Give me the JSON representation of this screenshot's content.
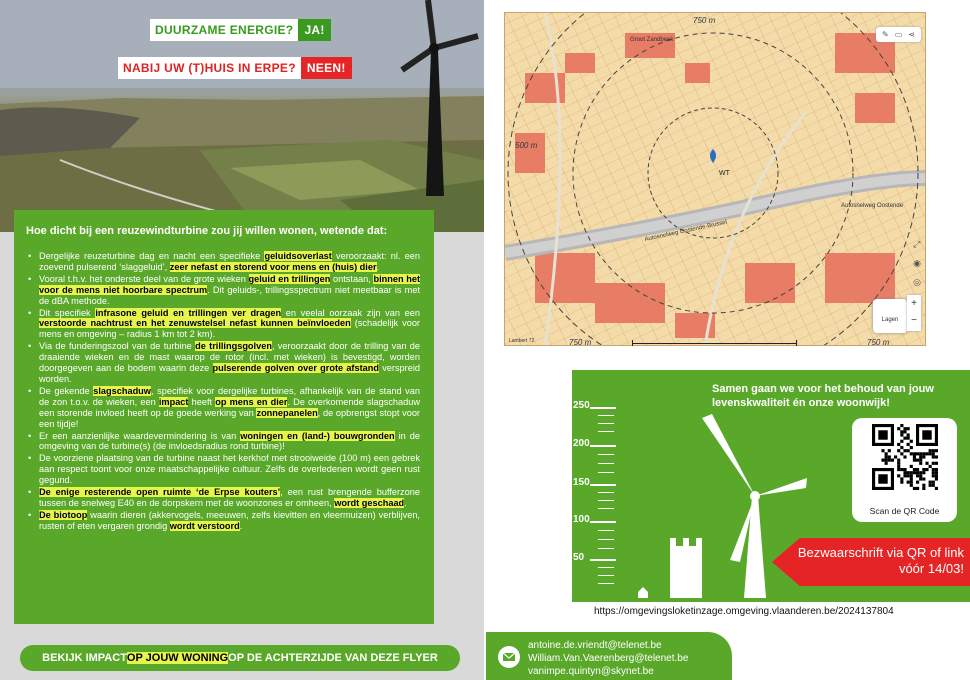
{
  "flyer_left": {
    "tag1": {
      "question": "DUURZAME ENERGIE?",
      "answer": "JA!"
    },
    "tag2": {
      "question": "NABIJ UW (T)HUIS IN ERPE?",
      "answer": "NEEN!"
    },
    "heading": "Hoe dicht bij een reuzewindturbine zou jij willen wonen, wetende dat:",
    "bullets": [
      [
        {
          "t": "Dergelijke reuzeturbine dag en nacht een specifieke "
        },
        {
          "t": "geluidsoverlast",
          "h": true
        },
        {
          "t": " veroorzaakt: nl. een zoevend pulserend ‘slaggeluid’, "
        },
        {
          "t": "zeer nefast en storend voor mens en (huis) dier",
          "h": true
        },
        {
          "t": "."
        }
      ],
      [
        {
          "t": "Vooral t.h.v. het onderste deel van de grote wieken "
        },
        {
          "t": "geluid en trillingen",
          "h": true
        },
        {
          "t": " ontstaan, "
        },
        {
          "t": "binnen het voor de mens niet hoorbare spectrum",
          "h": true
        },
        {
          "t": ". Dit geluids-, trillingsspectrum niet meetbaar is met de dBA methode."
        }
      ],
      [
        {
          "t": "Dit specifiek "
        },
        {
          "t": "infrasone geluid en trillingen ver dragen",
          "h": true
        },
        {
          "t": " en veelal oorzaak zijn van een "
        },
        {
          "t": "verstoorde nachtrust en het zenuwstelsel nefast kunnen beïnvloeden",
          "h": true
        },
        {
          "t": " (schadelijk voor mens en omgeving – radius 1 km tot 2 km)."
        }
      ],
      [
        {
          "t": "Via de funderingszool van de turbine "
        },
        {
          "t": "de trillingsgolven",
          "h": true
        },
        {
          "t": ", veroorzaakt door de trilling van de draaiende wieken en de mast waarop de rotor (incl. met wieken) is bevestigd, worden doorgegeven aan de bodem waarin deze "
        },
        {
          "t": "pulserende golven over grote afstand",
          "h": true
        },
        {
          "t": " verspreid worden."
        }
      ],
      [
        {
          "t": "De gekende "
        },
        {
          "t": "slagschaduw",
          "h": true
        },
        {
          "t": ", specifiek voor dergelijke turbines, afhankelijk van de stand van de zon t.o.v. de wieken, een "
        },
        {
          "t": "impact",
          "h": true
        },
        {
          "t": " heeft "
        },
        {
          "t": "op mens en dier",
          "h": true
        },
        {
          "t": ". De overkomende slagschaduw een storende invloed heeft op de goede werking van "
        },
        {
          "t": "zonnepanelen",
          "h": true
        },
        {
          "t": ", de opbrengst stopt voor een tijdje!"
        }
      ],
      [
        {
          "t": "Er een aanzienlijke waardevermindering is van "
        },
        {
          "t": "woningen en (land-) bouwgronden",
          "h": true
        },
        {
          "t": " in de omgeving van de turbine(s) (de invloedsradius rond turbine)!"
        }
      ],
      [
        {
          "t": "De voorziene plaatsing van de turbine naast het kerkhof met strooiweide (100 m) een gebrek aan respect toont voor onze maatschappelijke cultuur. Zelfs de overledenen wordt geen rust gegund."
        }
      ],
      [
        {
          "t": "De enige resterende open ruimte ‘de Erpse kouters’",
          "h": true
        },
        {
          "t": ", een rust brengende bufferzone tussen de snelweg E40 en de dorpskern met de woonzones er omheen, "
        },
        {
          "t": "wordt geschaad",
          "h": true
        },
        {
          "t": "."
        }
      ],
      [
        {
          "t": "De biotoop",
          "h": true
        },
        {
          "t": " waarin dieren (akkervogels, meeuwen, zelfs kievitten en vleermuizen) verblijven, rusten of eten vergaren grondig "
        },
        {
          "t": "wordt verstoord",
          "h": true
        },
        {
          "t": "."
        }
      ]
    ],
    "bottom_bar": {
      "pre": "BEKIJK IMPACT ",
      "mid": "OP JOUW WONING",
      "post": " OP DE ACHTERZIJDE VAN DEZE FLYER"
    }
  },
  "map": {
    "toolbar": [
      "✎",
      "▭",
      "⋖"
    ],
    "labels": [
      "Autosnelweg Oostende",
      "Autosnelweg Oostende-Brussel",
      "Groot Zandbeek",
      "WT",
      "Lagen"
    ],
    "handwritten": [
      "750 m",
      "500 m",
      "750 m",
      "750 m"
    ],
    "scale_text": "Lambert 72"
  },
  "info": {
    "heading": "Samen gaan we voor het behoud van jouw levenskwaliteit én onze woonwijk!",
    "gauge": [
      "250",
      "200",
      "150",
      "100",
      "50"
    ],
    "qr_label": "Scan de QR Code",
    "cta": "Bezwaarschrift via QR of link vóór 14/03!"
  },
  "url": "https://omgevingsloketinzage.omgeving.vlaanderen.be/2024137804",
  "contacts": [
    "antoine.de.vriendt@telenet.be",
    "William.Van.Vaerenberg@telenet.be",
    "vanimpe.quintyn@skynet.be"
  ],
  "colors": {
    "green": "#5aa829",
    "red": "#e52525",
    "highlight": "#e5f54b"
  }
}
